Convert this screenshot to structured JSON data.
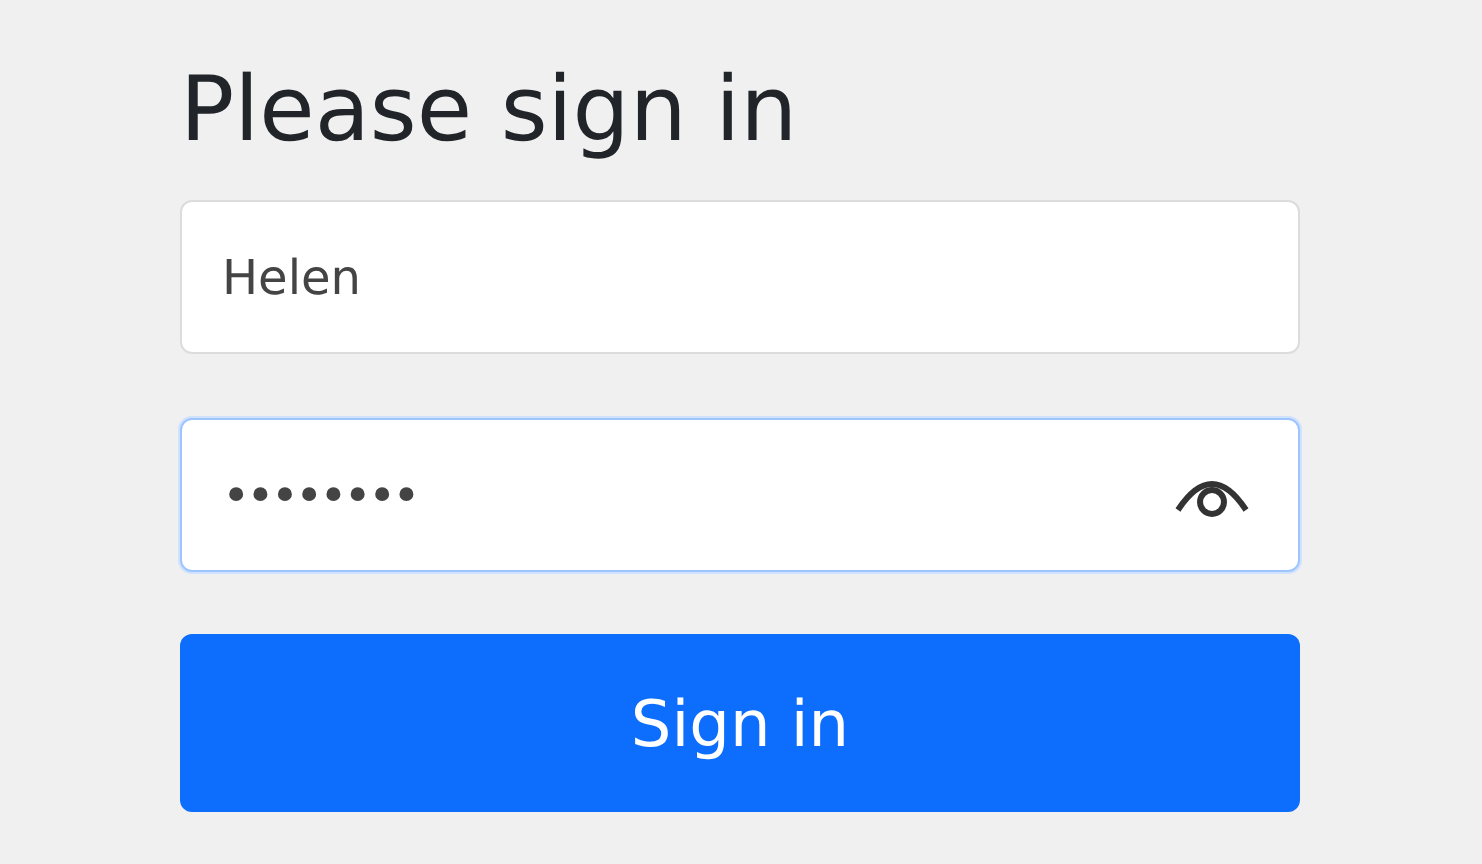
{
  "heading": "Please sign in",
  "fields": [
    {
      "kind": "text",
      "value": "Helen",
      "focused": false
    },
    {
      "kind": "password",
      "value": "••••••••",
      "focused": true
    }
  ],
  "button": "Sign in"
}
